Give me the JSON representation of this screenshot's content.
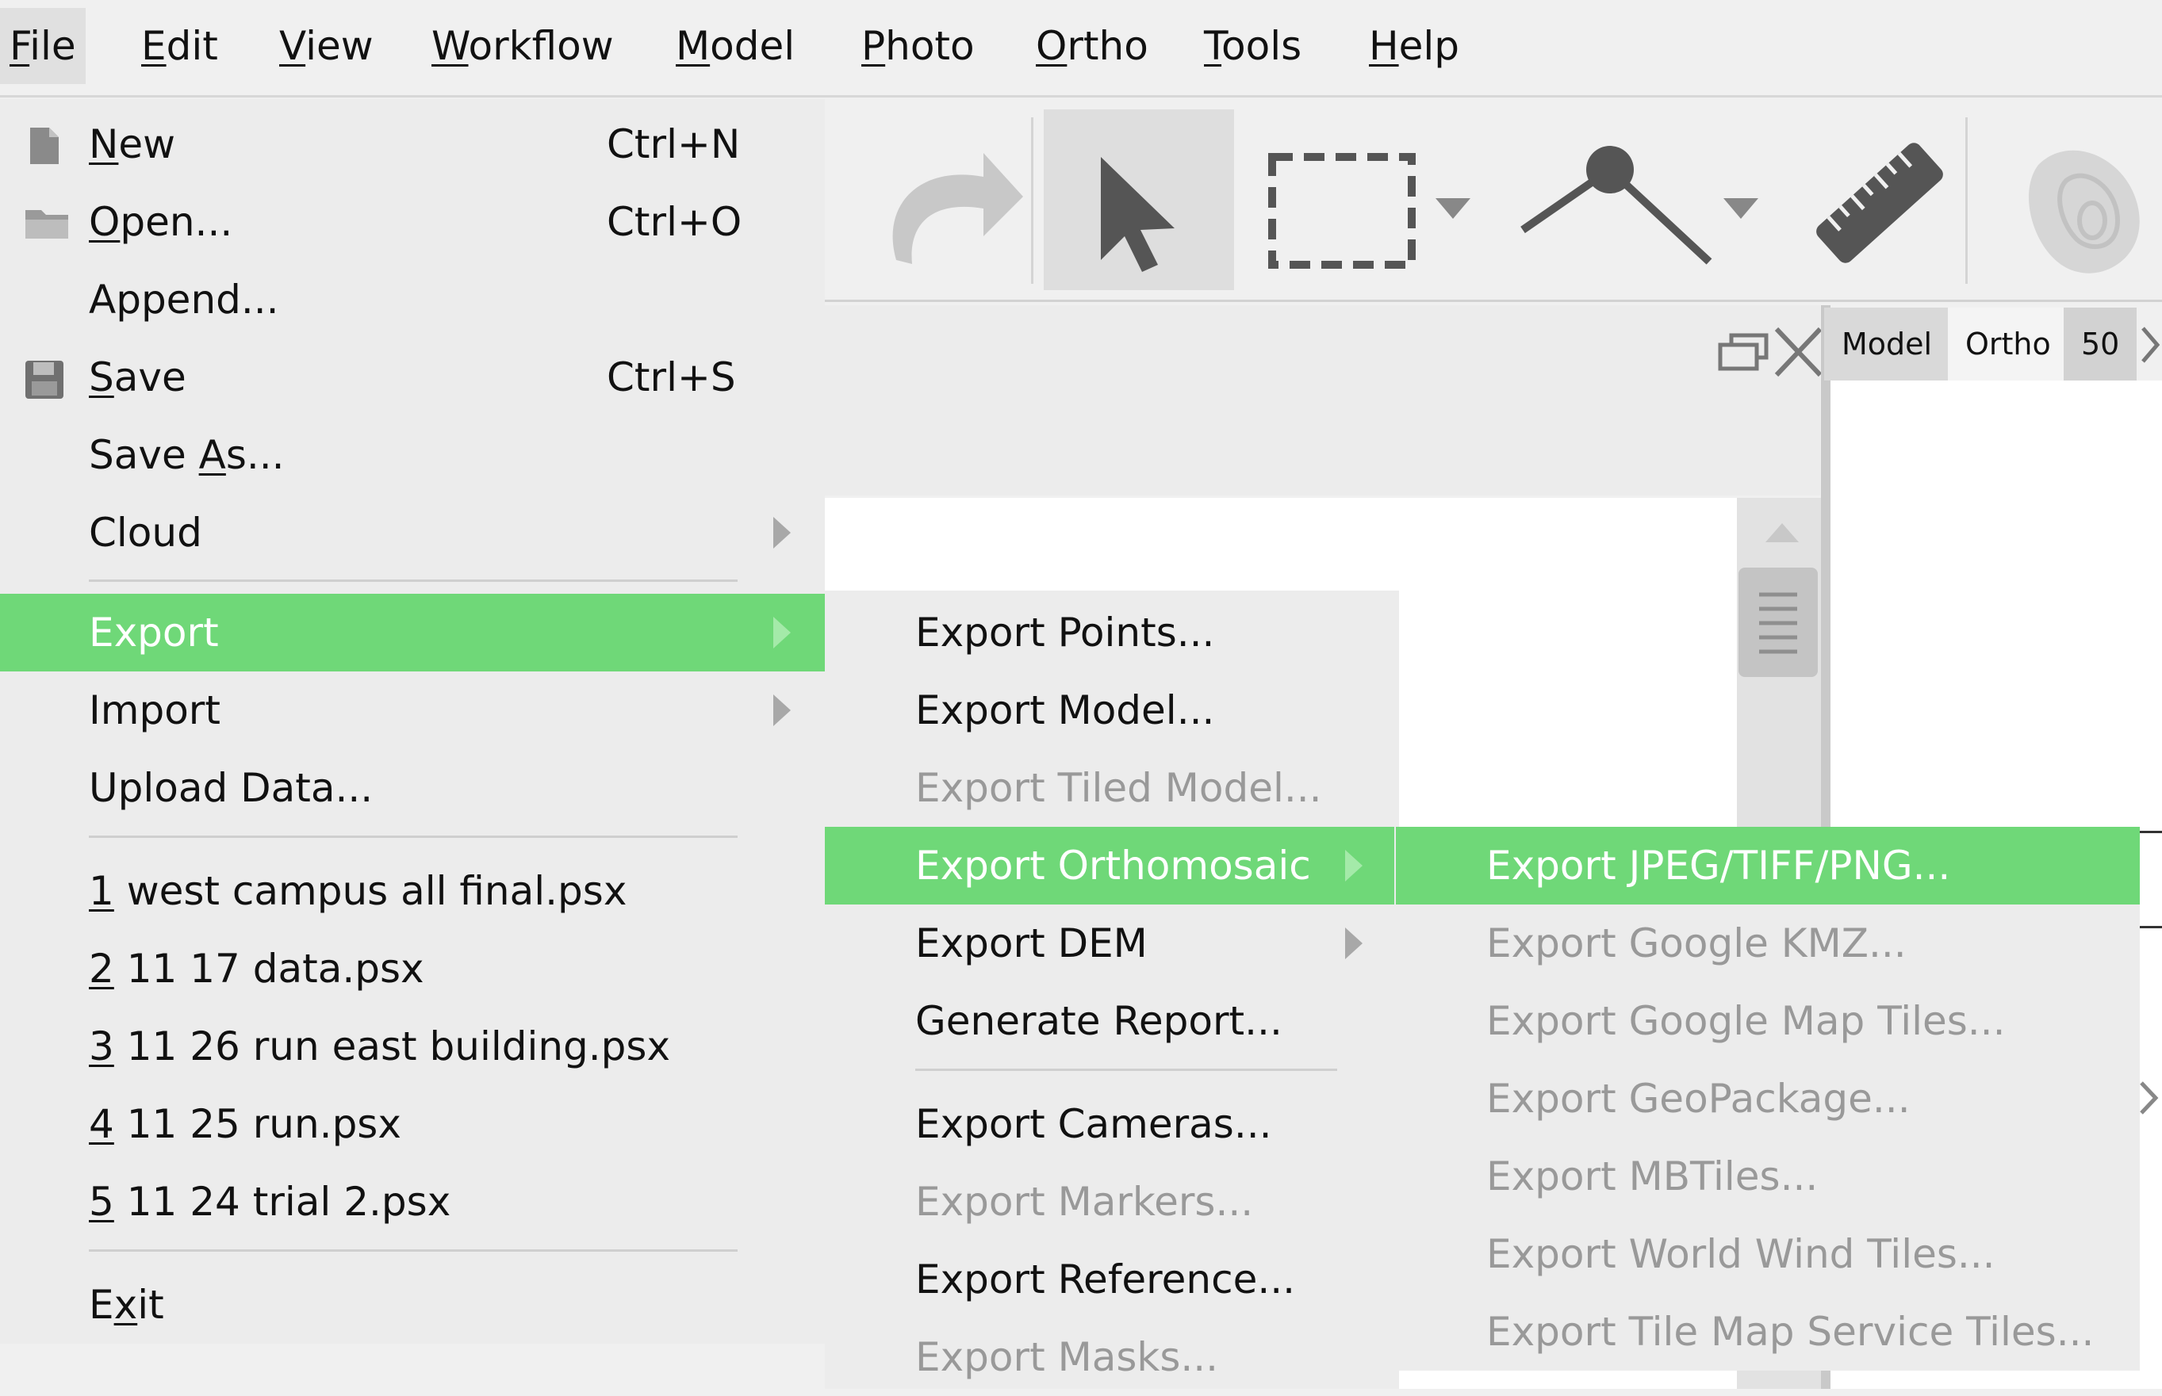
{
  "menubar": {
    "items": [
      {
        "mnemonic": "F",
        "rest": "ile"
      },
      {
        "mnemonic": "E",
        "rest": "dit"
      },
      {
        "mnemonic": "V",
        "rest": "iew"
      },
      {
        "mnemonic": "W",
        "rest": "orkflow"
      },
      {
        "mnemonic": "M",
        "rest": "odel"
      },
      {
        "mnemonic": "P",
        "rest": "hoto"
      },
      {
        "mnemonic": "O",
        "rest": "rtho"
      },
      {
        "mnemonic": "T",
        "rest": "ools"
      },
      {
        "mnemonic": "H",
        "rest": "elp"
      }
    ]
  },
  "tabs": {
    "model": "Model",
    "ortho": "Ortho",
    "third": "50"
  },
  "file_menu": {
    "new": {
      "mnemonic": "N",
      "rest": "ew",
      "shortcut": "Ctrl+N"
    },
    "open": {
      "mnemonic": "O",
      "rest": "pen...",
      "shortcut": "Ctrl+O"
    },
    "append": "Append...",
    "save": {
      "mnemonic": "S",
      "rest": "ave",
      "shortcut": "Ctrl+S"
    },
    "save_as": {
      "pre": "Save ",
      "mnemonic": "A",
      "rest": "s..."
    },
    "cloud": "Cloud",
    "export": "Export",
    "import": "Import",
    "upload": "Upload Data...",
    "recent": [
      {
        "num": "1",
        "name": " west campus all final.psx"
      },
      {
        "num": "2",
        "name": " 11 17 data.psx"
      },
      {
        "num": "3",
        "name": " 11 26 run east building.psx"
      },
      {
        "num": "4",
        "name": " 11 25 run.psx"
      },
      {
        "num": "5",
        "name": " 11 24 trial 2.psx"
      }
    ],
    "exit": {
      "pre": "E",
      "mnemonic": "x",
      "rest": "it"
    }
  },
  "export_menu": {
    "points": "Export Points...",
    "model": "Export Model...",
    "tiled_model": "Export Tiled Model...",
    "orthomosaic": "Export Orthomosaic",
    "dem": "Export DEM",
    "report": "Generate Report...",
    "cameras": "Export Cameras...",
    "markers": "Export Markers...",
    "reference": "Export Reference...",
    "masks": "Export Masks..."
  },
  "ortho_menu": {
    "jpeg": "Export JPEG/TIFF/PNG...",
    "kmz": "Export Google KMZ...",
    "map_tiles": "Export Google Map Tiles...",
    "geopackage": "Export GeoPackage...",
    "mbtiles": "Export MBTiles...",
    "world_wind": "Export World Wind Tiles...",
    "tms": "Export Tile Map Service Tiles..."
  }
}
